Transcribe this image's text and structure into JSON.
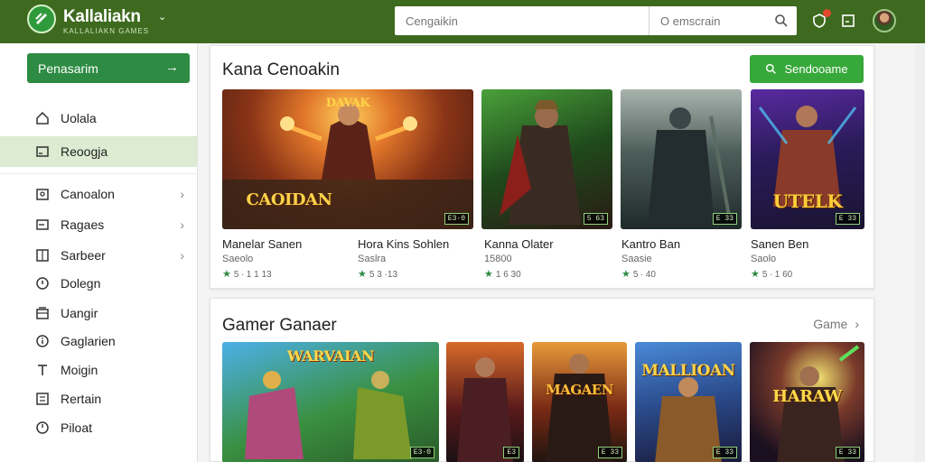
{
  "app": {
    "brand": "Kallaliakn",
    "brand_sub": "KALLALIAKN GAMES",
    "search_placeholder": "Cengaikin",
    "search_secondary_placeholder": "O emscrain"
  },
  "sidebar": {
    "primary_button": "Penasarim",
    "items": [
      {
        "label": "Uolala",
        "icon": "home-icon"
      },
      {
        "label": "Reoogja",
        "icon": "window-icon"
      },
      {
        "label": "Canoalon",
        "icon": "puzzle-icon"
      },
      {
        "label": "Ragaes",
        "icon": "window-icon"
      },
      {
        "label": "Sarbeer",
        "icon": "grid-icon"
      },
      {
        "label": "Dolegn",
        "icon": "location-icon"
      },
      {
        "label": "Uangir",
        "icon": "stack-icon"
      },
      {
        "label": "Gaglarien",
        "icon": "info-icon"
      },
      {
        "label": "Moigin",
        "icon": "pin-icon"
      },
      {
        "label": "Rertain",
        "icon": "list-icon"
      },
      {
        "label": "Piloat",
        "icon": "clock-icon"
      }
    ]
  },
  "section1": {
    "title": "Kana Cenoakin",
    "button": "Sendooame",
    "cards": [
      {
        "title": "Manelar Sanen",
        "sub": "Saeolo",
        "rating": "5 ∙ 1 1 13",
        "art_text": "CAOIDAN",
        "art_text2": "DAVAK",
        "badge": "E3·0"
      },
      {
        "title": "Hora Kins Sohlen",
        "sub": "Saslra",
        "rating": "5 3 ·13",
        "art_text": "",
        "art_text2": "",
        "badge": "5 63"
      },
      {
        "title": "Kanna Olater",
        "sub": "15800",
        "rating": "1 6 30",
        "art_text": "",
        "art_text2": "",
        "badge": "E 33"
      },
      {
        "title": "Kantro Ban",
        "sub": "Saasie",
        "rating": "5 ∙ 40",
        "art_text": "",
        "art_text2": "",
        "badge": "E 33"
      },
      {
        "title": "Sanen Ben",
        "sub": "Saolo",
        "rating": "5 ∙ 1 60",
        "art_text": "UTELK",
        "art_text2": "",
        "badge": "E 33"
      }
    ]
  },
  "section2": {
    "title": "Gamer Ganaer",
    "more": "Game",
    "cards": [
      {
        "art_text": "WARVAIAN",
        "badge": "E3·0"
      },
      {
        "art_text": "",
        "badge": "E3"
      },
      {
        "art_text": "MAGAEN",
        "badge": "E 33"
      },
      {
        "art_text": "MALLIOAN",
        "badge": "E 33"
      },
      {
        "art_text": "HARAW",
        "badge": "E 33"
      }
    ]
  },
  "colors": {
    "topbar": "#3e6a1f",
    "primary": "#2e8b43",
    "accent": "#37a83a",
    "active_item": "#dcebd1"
  }
}
